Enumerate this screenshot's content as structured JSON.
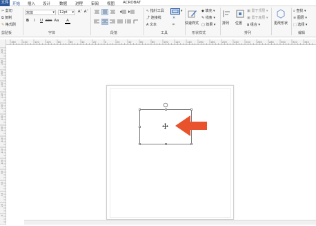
{
  "tabs": [
    "文件",
    "开始",
    "插入",
    "设计",
    "数据",
    "进程",
    "审阅",
    "视图",
    "ACROBAT"
  ],
  "active_tab": "开始",
  "clipboard": {
    "cut": "剪切",
    "copy": "复制",
    "paste_format": "格式刷",
    "label": "剪贴板"
  },
  "font": {
    "name": "宋体",
    "size": "12pt",
    "label": "字体",
    "bold": "B",
    "italic": "I",
    "underline": "U",
    "strike": "abc",
    "case": "Aa",
    "color_glyph": "A",
    "grow": "A˄",
    "shrink": "A˅"
  },
  "paragraph": {
    "label": "段落"
  },
  "tools": {
    "pointer": "指针工具",
    "connector": "连接线",
    "text": "文本",
    "label": "工具"
  },
  "shape_styles": {
    "quick": "快速样式",
    "fill": "填充",
    "line": "线条",
    "effect": "效果",
    "label": "形状样式"
  },
  "arrange": {
    "align": "排列",
    "position": "位置",
    "bring_front": "置于顶层",
    "send_back": "置于底层",
    "group": "组合",
    "label": "排列"
  },
  "shape_change": {
    "label": "更改形状"
  },
  "editing": {
    "find": "查找",
    "layer": "图层",
    "select": "选择",
    "label": "编辑"
  },
  "ruler_h": [
    "160",
    "140",
    "120",
    "100",
    "80",
    "60",
    "40",
    "20",
    "0",
    "20",
    "40",
    "60",
    "80",
    "100",
    "120",
    "140",
    "160",
    "180",
    "200",
    "220",
    "240",
    "260",
    "280",
    "300",
    "320",
    "340"
  ],
  "ruler_v": [
    "300",
    "280",
    "260",
    "240",
    "220",
    "200",
    "180",
    "160",
    "140",
    "120",
    "100",
    "80",
    "60",
    "40",
    "20",
    "0",
    "-20"
  ],
  "colors": {
    "accent": "#2b579a",
    "arrow": "#e8522c"
  }
}
